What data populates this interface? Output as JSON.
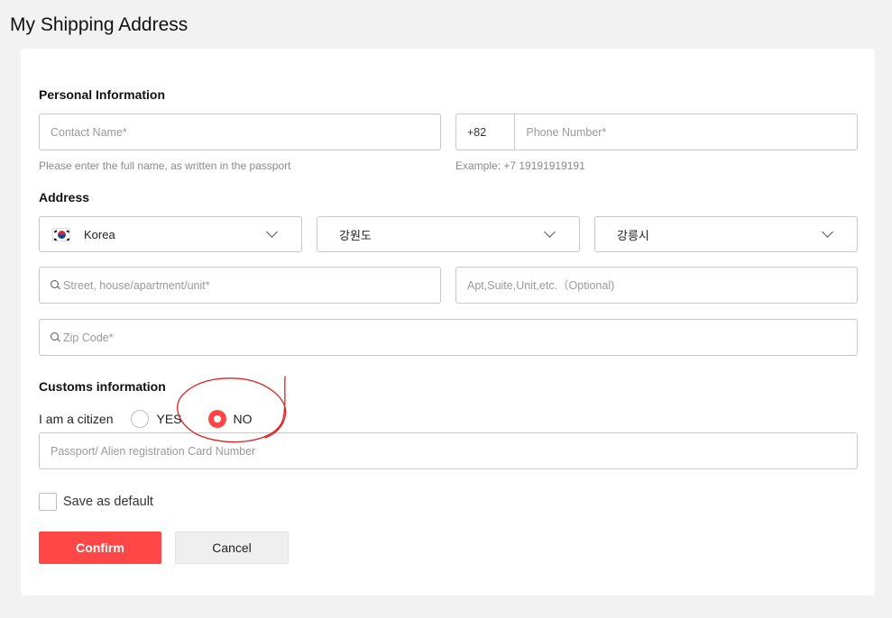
{
  "page": {
    "title": "My Shipping Address"
  },
  "personal": {
    "heading": "Personal Information",
    "contact_placeholder": "Contact Name*",
    "contact_helper": "Please enter the full name, as written in the passport",
    "phone_prefix": "+82",
    "phone_placeholder": "Phone Number*",
    "phone_helper": "Example: +7 19191919191"
  },
  "address": {
    "heading": "Address",
    "country": "Korea",
    "province": "강원도",
    "city": "강릉시",
    "street_placeholder": "Street, house/apartment/unit*",
    "apt_placeholder": "Apt,Suite,Unit,etc.（Optional)",
    "zip_placeholder": "Zip Code*"
  },
  "customs": {
    "heading": "Customs information",
    "citizen_label": "I am a citizen",
    "options": [
      {
        "label": "YES",
        "selected": false
      },
      {
        "label": "NO",
        "selected": true
      }
    ],
    "passport_placeholder": "Passport/ Alien registration Card Number"
  },
  "save_default": {
    "label": "Save as default",
    "checked": false
  },
  "actions": {
    "confirm": "Confirm",
    "cancel": "Cancel"
  },
  "colors": {
    "accent": "#ff4747",
    "annotation": "#e02020"
  }
}
